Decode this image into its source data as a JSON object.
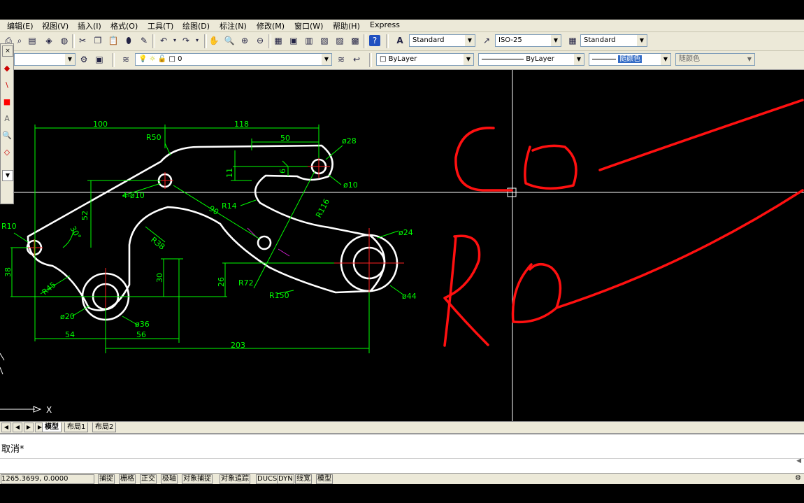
{
  "menu": [
    "编辑(E)",
    "视图(V)",
    "插入(I)",
    "格式(O)",
    "工具(T)",
    "绘图(D)",
    "标注(N)",
    "修改(M)",
    "窗口(W)",
    "帮助(H)",
    "Express"
  ],
  "toolbar": {
    "text_style": "Standard",
    "dim_style": "ISO-25",
    "table_style": "Standard",
    "layer_current": "0",
    "color": "ByLayer",
    "linetype": "ByLayer",
    "lineweight": "随颜色",
    "plot_style": "随颜色"
  },
  "drawing": {
    "dims": {
      "d100": "100",
      "d118": "118",
      "d50": "50",
      "d28": "ø28",
      "d10": "ø10",
      "r50": "R50",
      "d11": "11",
      "d6": "6",
      "four_holes": "4-ø10",
      "r14": "R14",
      "d90": "90",
      "r116": "R116",
      "d52": "52",
      "a30": "30°",
      "r10": "R10",
      "r38": "R38",
      "d24": "ø24",
      "d38": "38",
      "d30": "30",
      "d26": "26",
      "r45": "R45",
      "r72": "R72",
      "r150": "R150",
      "d44": "ø44",
      "d20": "ø20",
      "d36": "ø36",
      "d54": "54",
      "d56": "56",
      "d203": "203"
    },
    "ucs_x": "X",
    "stroke_colors": {
      "outline": "#ffffff",
      "dimension": "#00ff00",
      "center": "#ff2020",
      "markup": "#ff1010",
      "crosshair": "#ffffff",
      "magenta": "#d020d0"
    }
  },
  "tabs": [
    "模型",
    "布局1",
    "布局2"
  ],
  "command": {
    "history": "取消*",
    "prompt": ""
  },
  "status": {
    "coords": "1265.3699, 0.0000",
    "buttons": [
      "捕捉",
      "栅格",
      "正交",
      "极轴",
      "对象捕捉",
      "对象追踪",
      "DUCS",
      "DYN",
      "线宽",
      "模型"
    ]
  }
}
